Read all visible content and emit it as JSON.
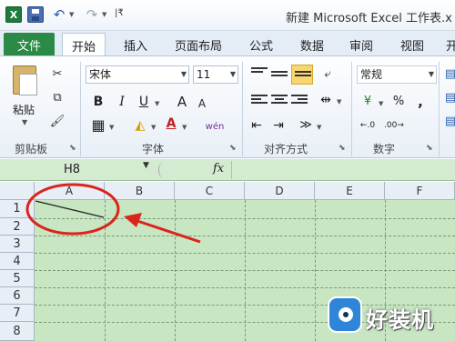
{
  "window": {
    "title": "新建 Microsoft Excel 工作表.x"
  },
  "qat": {
    "app_icon": "X",
    "separator": "|₹"
  },
  "tabs": [
    {
      "label": "文件"
    },
    {
      "label": "开始"
    },
    {
      "label": "插入"
    },
    {
      "label": "页面布局"
    },
    {
      "label": "公式"
    },
    {
      "label": "数据"
    },
    {
      "label": "审阅"
    },
    {
      "label": "视图"
    },
    {
      "label": "开"
    }
  ],
  "ribbon": {
    "clipboard": {
      "paste_label": "粘贴",
      "group_label": "剪贴板"
    },
    "font": {
      "name": "宋体",
      "size": "11",
      "bold": "B",
      "italic": "I",
      "underline": "U",
      "grow": "A",
      "shrink": "A",
      "font_color": "A",
      "phonetic": "wén",
      "group_label": "字体"
    },
    "alignment": {
      "group_label": "对齐方式"
    },
    "number": {
      "format": "常规",
      "percent": "%",
      "comma": ",",
      "group_label": "数字"
    }
  },
  "formula_bar": {
    "name_box": "H8",
    "fx": "fx",
    "value": ""
  },
  "sheet": {
    "columns": [
      "A",
      "B",
      "C",
      "D",
      "E",
      "F"
    ],
    "rows": [
      "1",
      "2",
      "3",
      "4",
      "5",
      "6",
      "7",
      "8"
    ],
    "annotation_color": "#d9251c",
    "cell_fill": "#c8e6c2"
  },
  "watermark": {
    "text": "好装机"
  },
  "icons": [
    "excel-icon",
    "save-icon",
    "undo-icon",
    "redo-icon",
    "paste-icon",
    "cut-icon",
    "copy-icon",
    "format-painter-icon",
    "borders-icon",
    "fill-color-icon",
    "wrap-text-icon",
    "merge-icon",
    "currency-icon",
    "decimal-icon",
    "fx-icon"
  ]
}
